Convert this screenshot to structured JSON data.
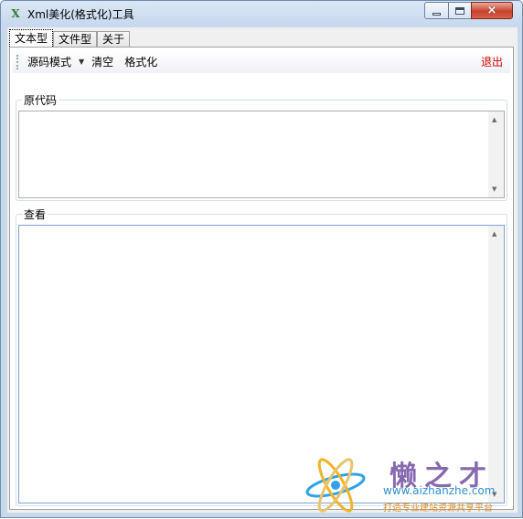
{
  "window": {
    "title": "Xml美化(格式化)工具",
    "app_icon": "X",
    "controls": {
      "minimize": "minimize-icon",
      "maximize": "maximize-icon",
      "close": "×"
    }
  },
  "tabs": [
    {
      "label": "文本型",
      "active": true
    },
    {
      "label": "文件型",
      "active": false
    },
    {
      "label": "关于",
      "active": false
    }
  ],
  "toolbar": {
    "mode_dropdown": "源码模式",
    "clear": "清空",
    "format": "格式化",
    "exit": "退出"
  },
  "source_group": {
    "label": "原代码",
    "value": ""
  },
  "view_group": {
    "label": "查看",
    "value": ""
  },
  "watermark": {
    "brand": "懒之才",
    "url": "www.aizhanzhe.com",
    "slogan": "打造专业建站资源共享平台"
  },
  "colors": {
    "exit": "#d00000",
    "titlebar": "#c9d9ec",
    "close_button": "#c7432f"
  }
}
